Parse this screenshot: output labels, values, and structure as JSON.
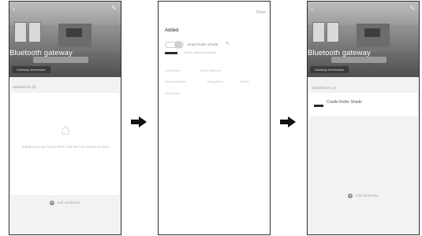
{
  "screen_before": {
    "title": "Bluetooth gateway",
    "pill": "Gateway Information",
    "section_label": "Subdevices (0)",
    "empty_text": "Subdevices are found when add the new device to start",
    "add_label": "Add subdevice"
  },
  "screen_adding": {
    "done_label": "Done",
    "added_title": "Added",
    "device_name": "Smart Roller Shade",
    "device_sub": "Device added successfully",
    "rooms": [
      "Living Room",
      "Master Bedroom",
      "Second Bedroom",
      "Dining Room",
      "Kitchen",
      "Study Room"
    ]
  },
  "screen_after": {
    "title": "Bluetooth gateway",
    "pill": "Gateway Information",
    "section_label": "Subdevices (1)",
    "device_name": "Cradle Roller Shade",
    "add_label": "Add subdevice"
  },
  "icons": {
    "back": "back-chevron-icon",
    "edit": "edit-pencil-icon",
    "empty": "empty-box-icon",
    "add": "plus-circle-icon",
    "arrow": "right-arrow-icon"
  },
  "colors": {
    "frame": "#2d2d2d",
    "arrow": "#111111",
    "accent_bar": "#2a2a2a"
  }
}
